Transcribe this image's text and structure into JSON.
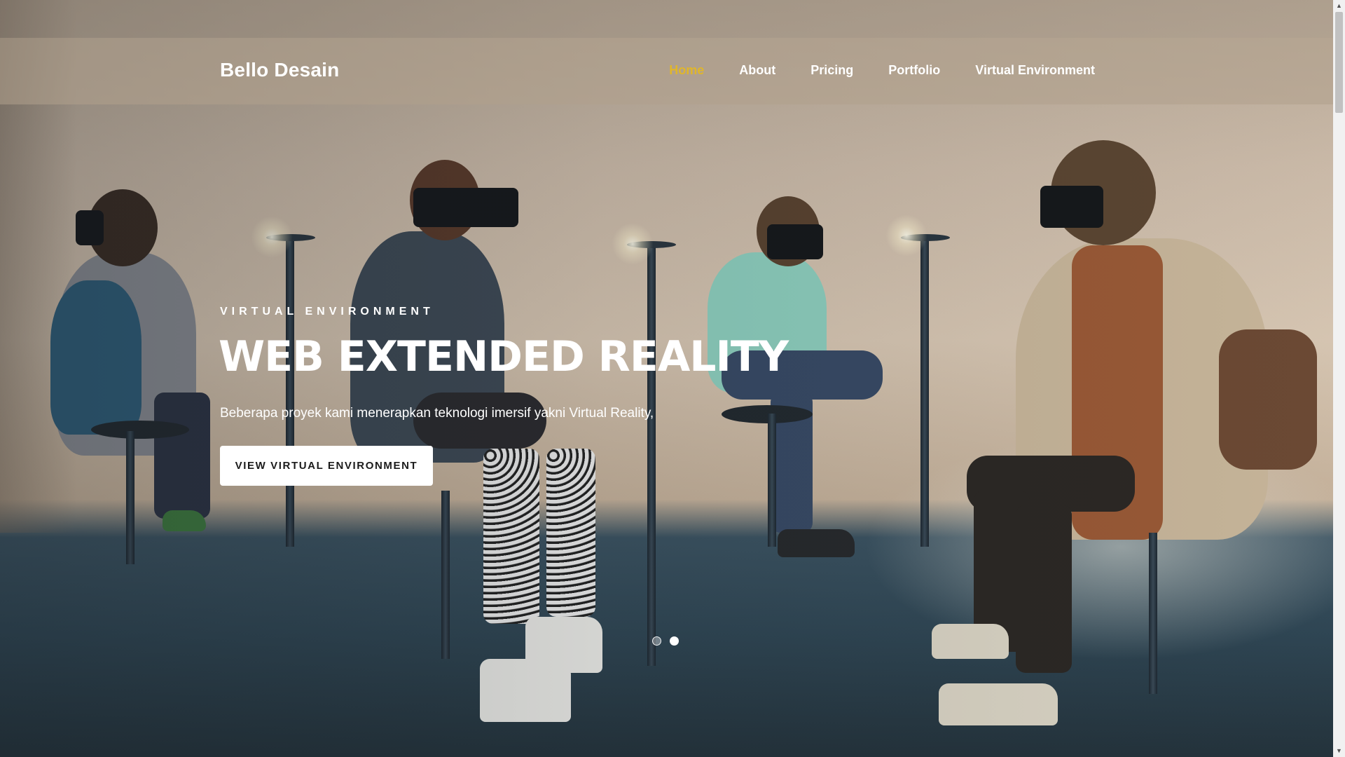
{
  "navbar": {
    "brand": "Bello Desain",
    "links": [
      {
        "label": "Home",
        "active": true
      },
      {
        "label": "About",
        "active": false
      },
      {
        "label": "Pricing",
        "active": false
      },
      {
        "label": "Portfolio",
        "active": false
      },
      {
        "label": "Virtual Environment",
        "active": false
      }
    ],
    "active_color": "#e0b62a"
  },
  "hero": {
    "eyebrow": "VIRTUAL ENVIRONMENT",
    "headline": "WEB EXTENDED REALITY",
    "lead": "Beberapa proyek kami menerapkan teknologi imersif yakni Virtual Reality,",
    "cta_label": "VIEW VIRTUAL ENVIRONMENT",
    "background_image": "people-wearing-vr-headsets-photo"
  },
  "carousel": {
    "slide_count": 2,
    "active_index": 1
  },
  "scrollbar": {
    "up_icon": "scroll-up-arrow-icon",
    "down_icon": "scroll-down-arrow-icon"
  }
}
